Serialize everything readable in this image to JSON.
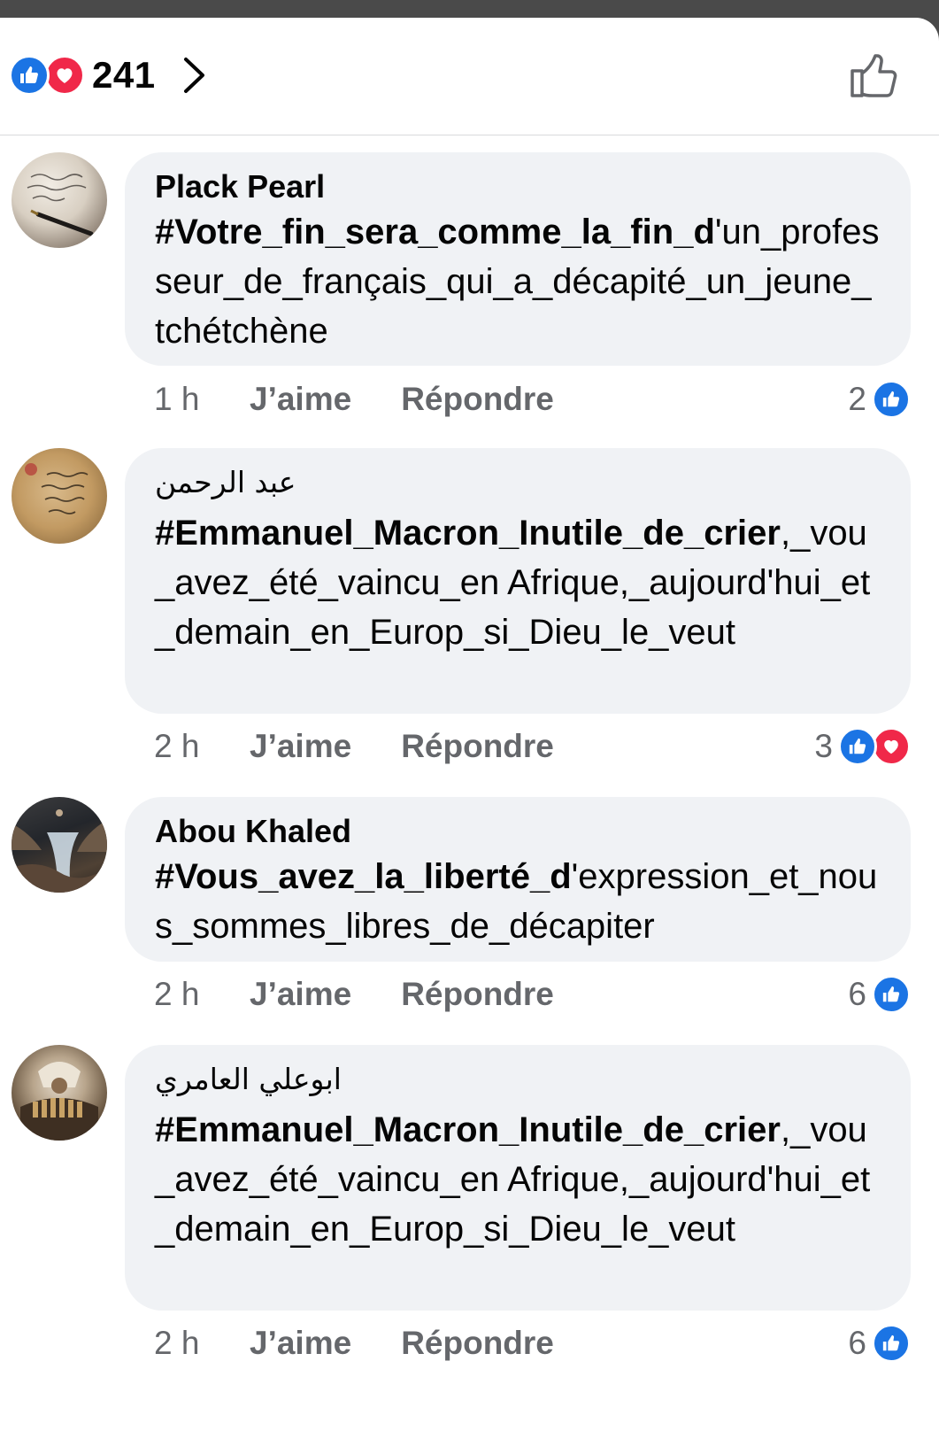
{
  "header": {
    "reaction_total": "241",
    "reaction_icons": [
      "like-icon",
      "love-icon"
    ],
    "chevron_icon": "chevron-right-icon",
    "like_button_icon": "thumbs-up-outline-icon"
  },
  "colors": {
    "like": "#1b74e4",
    "love": "#f02849",
    "bubble": "#f0f2f5",
    "meta": "#65676b"
  },
  "comments": [
    {
      "author": "Plack Pearl",
      "text_bold": "#Votre_fin_sera_comme_la_fin_d",
      "text_rest": "'un_professeur_de_français_qui_a_décapité_un_jeune_tchétchène",
      "time": "1 h",
      "like_label": "J’aime",
      "reply_label": "Répondre",
      "reaction_count": "2"
    },
    {
      "author": "عبد الرحمن",
      "text_bold": "#Emmanuel_Macron_Inutile_de_crier",
      "text_rest": ",_vou_avez_été_vaincu_en Afrique,_aujourd'hui_et_demain_en_Europ_si_Dieu_le_veut",
      "time": "2 h",
      "like_label": "J’aime",
      "reply_label": "Répondre",
      "reaction_count": "3"
    },
    {
      "author": "Abou Khaled",
      "text_bold": "#Vous_avez_la_liberté_d",
      "text_rest": "'expression_et_nous_sommes_libres_de_décapiter",
      "time": "2 h",
      "like_label": "J’aime",
      "reply_label": "Répondre",
      "reaction_count": "6"
    },
    {
      "author": "ابوعلي العامري",
      "text_bold": "#Emmanuel_Macron_Inutile_de_crier",
      "text_rest": ",_vou_avez_été_vaincu_en Afrique,_aujourd'hui_et_demain_en_Europ_si_Dieu_le_veut",
      "time": "2 h",
      "like_label": "J’aime",
      "reply_label": "Répondre",
      "reaction_count": "6"
    }
  ]
}
